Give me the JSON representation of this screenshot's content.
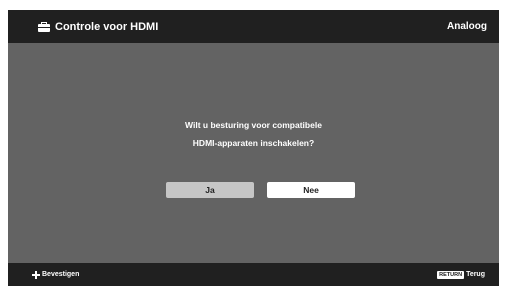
{
  "header": {
    "title": "Controle voor HDMI",
    "title_icon": "toolbox-icon",
    "source": "Analoog"
  },
  "dialog": {
    "line1": "Wilt u besturing voor compatibele",
    "line2": "HDMI-apparaten inschakelen?",
    "buttons": {
      "yes": "Ja",
      "no": "Nee"
    }
  },
  "footer": {
    "confirm_icon": "dpad-icon",
    "confirm_label": "Bevestigen",
    "return_badge": "RETURN",
    "return_label": "Terug"
  },
  "colors": {
    "background": "#636363",
    "bars": "#202020",
    "selected_button": "#c6c6c6",
    "button": "#ffffff"
  }
}
